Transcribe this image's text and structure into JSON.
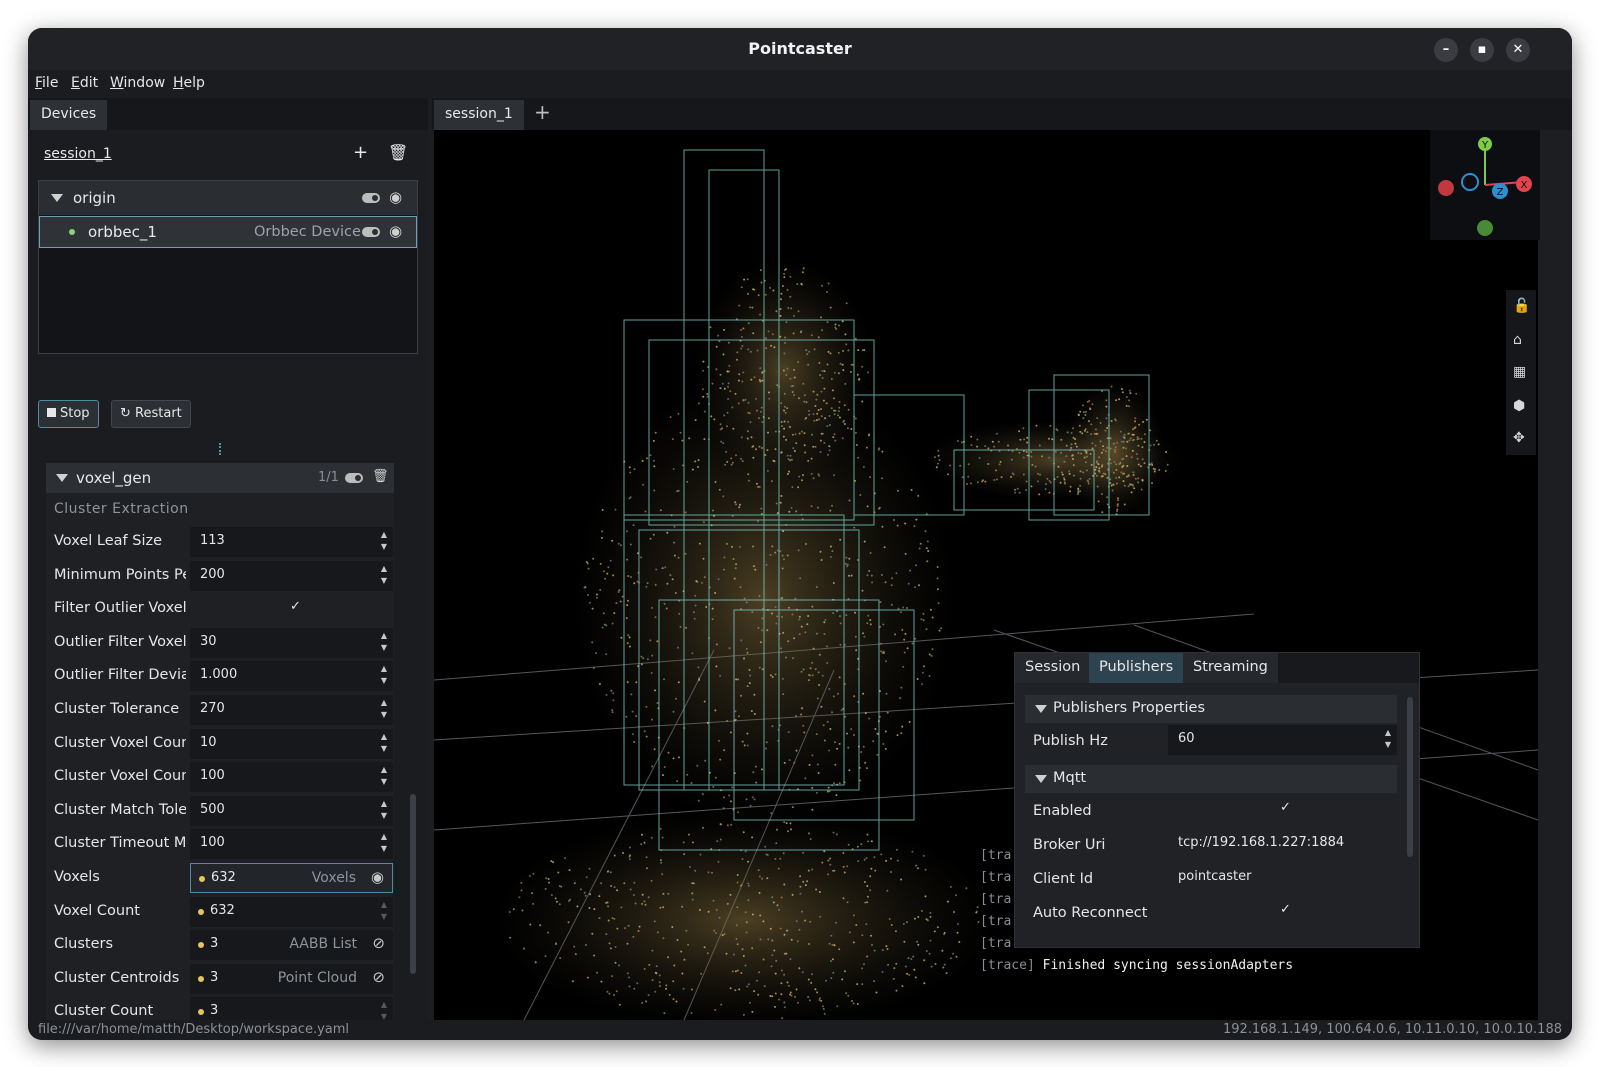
{
  "window": {
    "title": "Pointcaster"
  },
  "menu": {
    "items": [
      {
        "label": "File",
        "accel": "F",
        "rest": "ile"
      },
      {
        "label": "Edit",
        "accel": "E",
        "rest": "dit"
      },
      {
        "label": "Window",
        "accel": "W",
        "rest": "indow"
      },
      {
        "label": "Help",
        "accel": "H",
        "rest": "elp"
      }
    ]
  },
  "devices": {
    "tab_label": "Devices",
    "session_name": "session_1",
    "origin_label": "origin",
    "device_name": "orbbec_1",
    "device_type": "Orbbec Device",
    "stop_label": "Stop",
    "restart_label": "Restart"
  },
  "operator": {
    "name": "voxel_gen",
    "count": "1/1",
    "group": "Cluster Extraction",
    "props": [
      {
        "label": "Voxel Leaf Size",
        "value": "113",
        "kind": "number"
      },
      {
        "label": "Minimum Points Pe",
        "value": "200",
        "kind": "number"
      },
      {
        "label": "Filter Outlier Voxels",
        "value": "✓",
        "kind": "check"
      },
      {
        "label": "Outlier Filter Voxel C",
        "value": "30",
        "kind": "number"
      },
      {
        "label": "Outlier Filter Deviati",
        "value": "1.000",
        "kind": "number"
      },
      {
        "label": "Cluster Tolerance",
        "value": "270",
        "kind": "number"
      },
      {
        "label": "Cluster Voxel Count",
        "value": "10",
        "kind": "number"
      },
      {
        "label": "Cluster Voxel Count",
        "value": "100",
        "kind": "number"
      },
      {
        "label": "Cluster Match Tolera",
        "value": "500",
        "kind": "number"
      },
      {
        "label": "Cluster Timeout Ms",
        "value": "100",
        "kind": "number"
      },
      {
        "label": "Voxels",
        "value": "632",
        "kind": "output",
        "type": "Voxels",
        "visible": true
      },
      {
        "label": "Voxel Count",
        "value": "632",
        "kind": "output-number"
      },
      {
        "label": "Clusters",
        "value": "3",
        "kind": "output",
        "type": "AABB List",
        "visible": false
      },
      {
        "label": "Cluster Centroids",
        "value": "3",
        "kind": "output",
        "type": "Point Cloud",
        "visible": false
      },
      {
        "label": "Cluster Count",
        "value": "3",
        "kind": "output-number"
      }
    ]
  },
  "viewport": {
    "tab_label": "session_1",
    "gizmo_labels": {
      "y": "Y",
      "x": "X",
      "z": "Z"
    }
  },
  "log": {
    "lines": [
      {
        "level": "[tra",
        "text": ""
      },
      {
        "level": "[tra",
        "text": ""
      },
      {
        "level": "[tra",
        "text": ""
      },
      {
        "level": "[tra",
        "text": ""
      },
      {
        "level": "[tra",
        "text": ""
      },
      {
        "level": "[trace]",
        "text": "Finished syncing sessionAdapters"
      }
    ]
  },
  "publishers": {
    "tabs": [
      "Session",
      "Publishers",
      "Streaming"
    ],
    "active_tab": "Publishers",
    "section_props": "Publishers Properties",
    "publish_hz_label": "Publish Hz",
    "publish_hz_value": "60",
    "section_mqtt": "Mqtt",
    "enabled_label": "Enabled",
    "enabled_value": "✓",
    "broker_label": "Broker Uri",
    "broker_value": "tcp://192.168.1.227:1884",
    "client_label": "Client Id",
    "client_value": "pointcaster",
    "reconnect_label": "Auto Reconnect",
    "reconnect_value": "✓"
  },
  "status": {
    "path": "file:///var/home/matth/Desktop/workspace.yaml",
    "ips": "192.168.1.149, 100.64.0.6, 10.11.0.10, 10.0.10.188"
  },
  "colors": {
    "accent": "#4f8ca3",
    "device_dot": "#8bd17c",
    "output_dot": "#e8c45a",
    "gizmo_x": "#e0454f",
    "gizmo_y": "#7ccc4a",
    "gizmo_z": "#2d8fd0"
  }
}
